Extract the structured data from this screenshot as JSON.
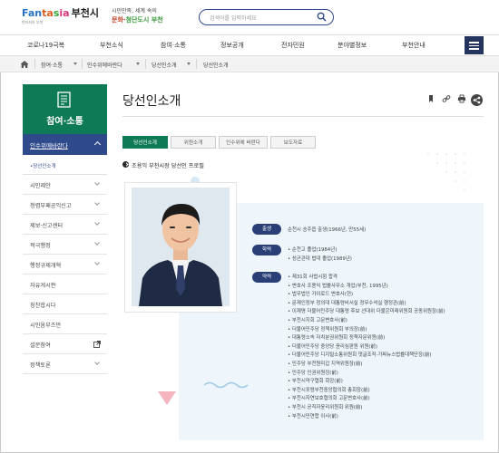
{
  "header": {
    "logo_word": [
      "Fan",
      "ta",
      "s",
      "ia"
    ],
    "logo_city": "부천시",
    "logo_sub": "판타지아 부천",
    "slogan_line1": "시민만족, 세계 속의",
    "slogan_line2a": "문화·",
    "slogan_line2b": "첨단도시 부천",
    "search_placeholder": "검색어를 입력하세요"
  },
  "gnb": [
    "코로나19극복",
    "부천소식",
    "참여·소통",
    "정보공개",
    "전자민원",
    "분야별정보",
    "부천안내"
  ],
  "breadcrumb": [
    "참여·소통",
    "인수위에바란다",
    "당선인소개",
    "당선인소개"
  ],
  "sidebar": {
    "title": "참여·소통",
    "active": "인수위에바란다",
    "active_sub": "•당선인소개",
    "items": [
      "시민제안",
      "청렴부패공익신고",
      "제보·신고센터",
      "적극행정",
      "행정규제개혁",
      "자유게시판",
      "칭찬합시다",
      "시민옴부즈만",
      "설문참여",
      "정책토론"
    ]
  },
  "content": {
    "title": "당선인소개",
    "tabs": [
      "당선인소개",
      "위원소개",
      "인수위에 바란다",
      "보도자료"
    ],
    "section_title": "조용익 부천시장 당선인 프로필",
    "birth_label": "출생",
    "birth": "순천시 승주읍 출생(1966년, 만55세)",
    "edu_label": "학력",
    "education": [
      "순천고 졸업(1984년)",
      "성균관대 법대 졸업(1989년)"
    ],
    "career_label": "약력",
    "career": [
      "제31회 사법시험 합격",
      "변호사 조용익 법률사무소 개업(부천, 1995년)",
      "법무법인 가이로드 변호사(현)",
      "문재인정부 정의대 대통령비서실 정무수석실 행정관(前)",
      "이재명 더불어민주당 대통령 후보 선대위 더불은미래위원회 공동위원장(前)",
      "부천시지회 고문변호사(前)",
      "더불어민주당 정책위원회 부의장(前)",
      "대통령소속 자치분권위원회 정책자문위원(前)",
      "더불어민주당 중앙당 윤리심판원 위원(前)",
      "더불어민주당 디지털소통위원회 댓글조작·가짜뉴스법률대책단장(前)",
      "민주당 부천원미갑 지역위원장(前)",
      "민주당 인권위원장(前)",
      "부천시약구협회 회장(前)",
      "부천시포럼부천중앙협의회 총회장(前)",
      "부천시자연보호협의회 고문변호사(前)",
      "부천시 공직자윤리위원회 위원(前)",
      "부천시민연합 이사(前)"
    ]
  }
}
